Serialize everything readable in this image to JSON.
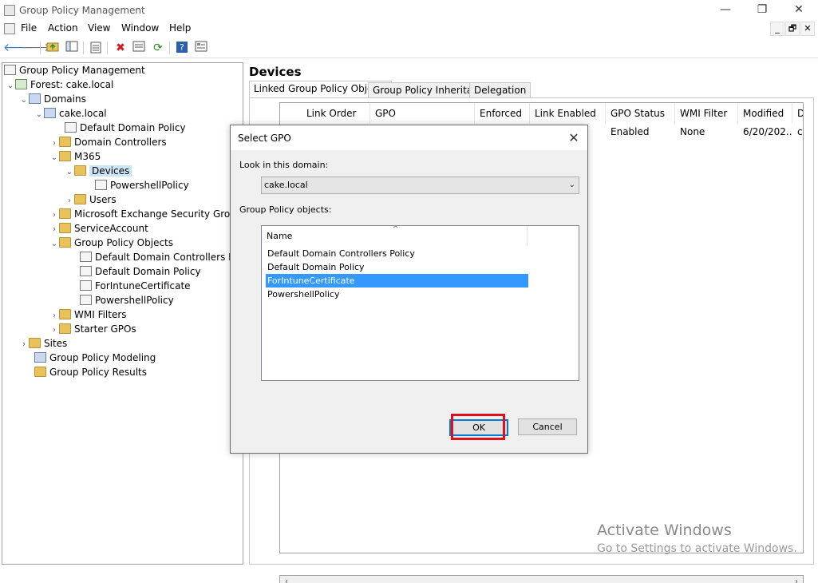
{
  "window": {
    "title": "Group Policy Management",
    "minimize_glyph": "—",
    "maximize_glyph": "❐",
    "close_glyph": "✕"
  },
  "menu": {
    "items": [
      "File",
      "Action",
      "View",
      "Window",
      "Help"
    ],
    "mdi_min": "_",
    "mdi_restore": "🗗",
    "mdi_close": "✕"
  },
  "toolbar": {
    "icons": [
      "back-arrow-icon",
      "forward-arrow-icon",
      "up-folder-icon",
      "show-hide-tree-icon",
      "properties-icon",
      "delete-icon",
      "export-list-icon",
      "refresh-icon",
      "help-icon",
      "view-icon"
    ]
  },
  "tree": {
    "root": "Group Policy Management",
    "forest": "Forest: cake.local",
    "domains": "Domains",
    "domain": "cake.local",
    "default_domain_policy": "Default Domain Policy",
    "domain_controllers": "Domain Controllers",
    "m365": "M365",
    "devices": "Devices",
    "powershell_policy_link": "PowershellPolicy",
    "users": "Users",
    "ms_exchange": "Microsoft Exchange Security Groups",
    "service_account": "ServiceAccount",
    "gpo_container": "Group Policy Objects",
    "gpo_items": [
      "Default Domain Controllers Policy",
      "Default Domain Policy",
      "ForIntuneCertificate",
      "PowershellPolicy"
    ],
    "wmi_filters": "WMI Filters",
    "starter_gpos": "Starter GPOs",
    "sites": "Sites",
    "modeling": "Group Policy Modeling",
    "results": "Group Policy Results"
  },
  "right_pane": {
    "title": "Devices",
    "tabs": [
      "Linked Group Policy Objects",
      "Group Policy Inheritance",
      "Delegation"
    ],
    "columns": [
      "Link Order",
      "GPO",
      "Enforced",
      "Link Enabled",
      "GPO Status",
      "WMI Filter",
      "Modified",
      "D"
    ],
    "row": {
      "gpo_status": "Enabled",
      "wmi_filter": "None",
      "modified": "6/20/202...",
      "domain": "ca"
    }
  },
  "watermark": {
    "line1": "Activate Windows",
    "line2": "Go to Settings to activate Windows."
  },
  "dialog": {
    "title": "Select GPO",
    "look_in_label": "Look in this domain:",
    "domain_value": "cake.local",
    "gpo_list_label": "Group Policy objects:",
    "name_header": "Name",
    "items": [
      "Default Domain Controllers Policy",
      "Default Domain Policy",
      "ForIntuneCertificate",
      "PowershellPolicy"
    ],
    "selected_index": 2,
    "ok_label": "OK",
    "cancel_label": "Cancel",
    "close_glyph": "✕"
  },
  "colors": {
    "selection": "#3399ff",
    "highlight_box": "#e0101a",
    "folder": "#e8c25a"
  }
}
